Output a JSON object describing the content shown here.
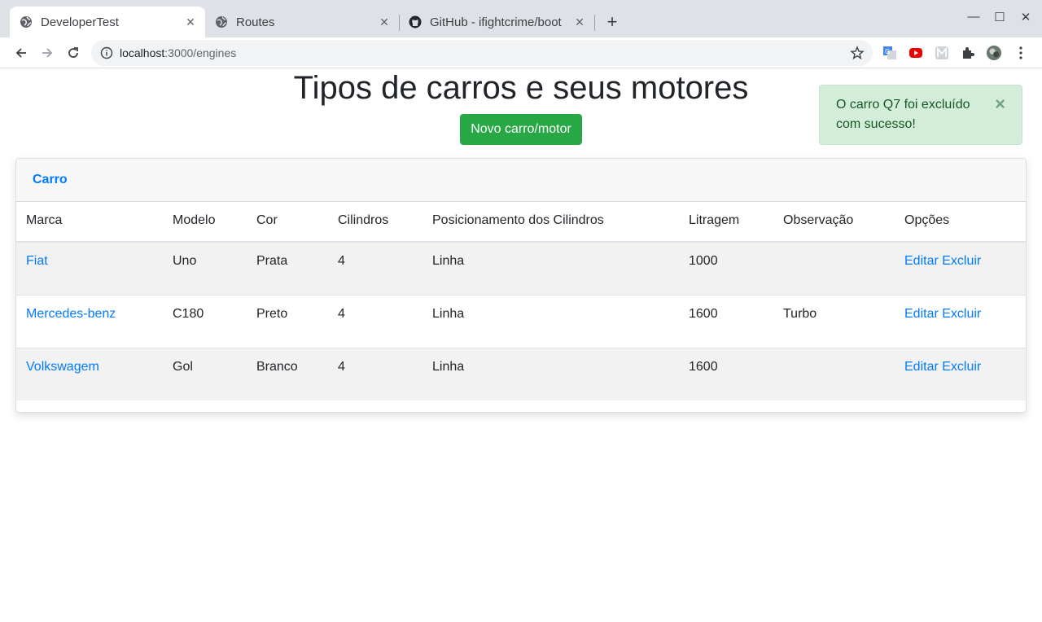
{
  "browser": {
    "tabs": [
      {
        "title": "DeveloperTest",
        "icon": "globe-icon",
        "active": true
      },
      {
        "title": "Routes",
        "icon": "globe-icon",
        "active": false
      },
      {
        "title": "GitHub - ifightcrime/boot",
        "icon": "github-icon",
        "active": false
      }
    ],
    "url_host": "localhost",
    "url_path": ":3000/engines"
  },
  "page": {
    "title": "Tipos de carros e seus motores",
    "new_button": "Novo carro/motor",
    "alert": {
      "message": "O carro Q7 foi excluído com sucesso!",
      "close": "×"
    },
    "card_header": "Carro",
    "columns": [
      "Marca",
      "Modelo",
      "Cor",
      "Cilindros",
      "Posicionamento dos Cilindros",
      "Litragem",
      "Observação",
      "Opções"
    ],
    "rows": [
      {
        "marca": "Fiat",
        "modelo": "Uno",
        "cor": "Prata",
        "cilindros": "4",
        "posicionamento": "Linha",
        "litragem": "1000",
        "observacao": "",
        "edit": "Editar",
        "delete": "Excluir"
      },
      {
        "marca": "Mercedes-benz",
        "modelo": "C180",
        "cor": "Preto",
        "cilindros": "4",
        "posicionamento": "Linha",
        "litragem": "1600",
        "observacao": "Turbo",
        "edit": "Editar",
        "delete": "Excluir"
      },
      {
        "marca": "Volkswagem",
        "modelo": "Gol",
        "cor": "Branco",
        "cilindros": "4",
        "posicionamento": "Linha",
        "litragem": "1600",
        "observacao": "",
        "edit": "Editar",
        "delete": "Excluir"
      }
    ]
  },
  "colors": {
    "success": "#28a745",
    "link": "#007bff",
    "alert_bg": "#d4edda",
    "alert_text": "#155724"
  }
}
